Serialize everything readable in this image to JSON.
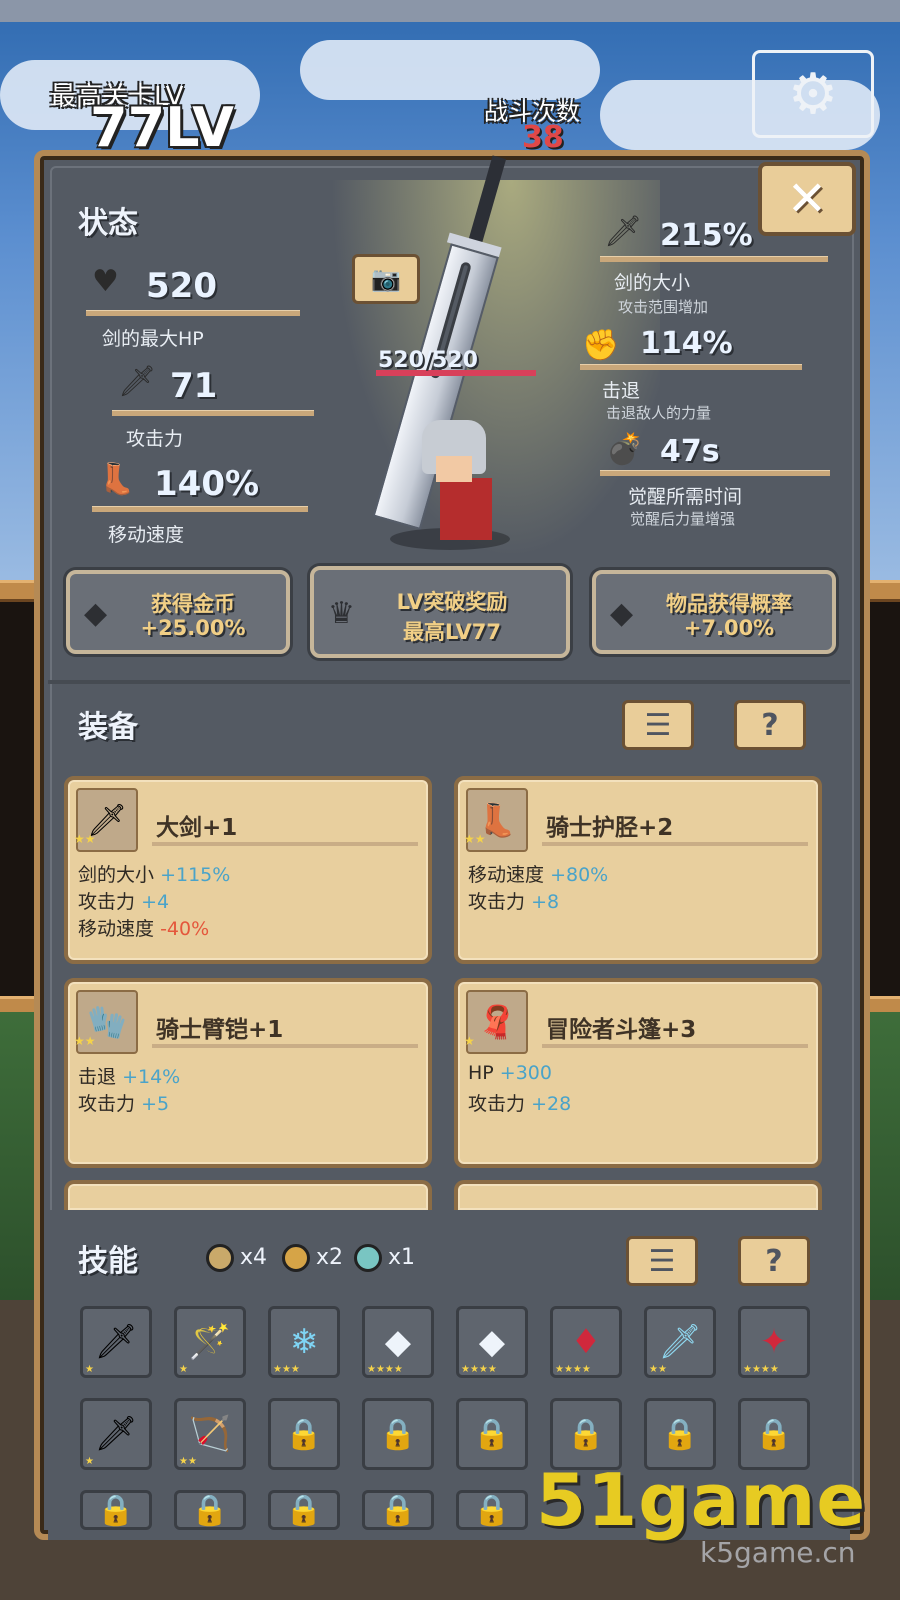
{
  "hud": {
    "best_stage_label": "最高关卡LV",
    "best_stage_value": "77LV",
    "battle_count_label": "战斗次数",
    "battle_count_value": "38"
  },
  "status": {
    "title": "状态",
    "left_stats": [
      {
        "value": "520",
        "label": "剑的最大HP",
        "icon": "heart-icon"
      },
      {
        "value": "71",
        "label": "攻击力",
        "icon": "sword-icon"
      },
      {
        "value": "140%",
        "label": "移动速度",
        "icon": "boots-icon"
      }
    ],
    "right_stats": [
      {
        "value": "215%",
        "label": "剑的大小",
        "sub": "攻击范围增加",
        "icon": "sword-icon"
      },
      {
        "value": "114%",
        "label": "击退",
        "sub": "击退敌人的力量",
        "icon": "fist-icon"
      },
      {
        "value": "47s",
        "label": "觉醒所需时间",
        "sub": "觉醒后力量增强",
        "icon": "bomb-icon"
      }
    ],
    "hp_text": "520/520"
  },
  "bonuses": [
    {
      "title": "获得金币",
      "value": "+25.00%",
      "icon": "diamond-icon"
    },
    {
      "title": "LV突破奖励",
      "value": "最高LV77",
      "icon": "crown-icon"
    },
    {
      "title": "物品获得概率",
      "value": "+7.00%",
      "icon": "diamond-icon"
    }
  ],
  "equipment": {
    "title": "装备",
    "menu_label": "☰",
    "help_label": "?",
    "items": [
      {
        "name": "大剑+1",
        "icon": "greatsword-icon",
        "stats": [
          {
            "label": "剑的大小",
            "value": "+115%",
            "sign": "pos"
          },
          {
            "label": "攻击力",
            "value": "+4",
            "sign": "pos"
          },
          {
            "label": "移动速度",
            "value": "-40%",
            "sign": "neg"
          }
        ]
      },
      {
        "name": "骑士护胫+2",
        "icon": "greaves-icon",
        "stats": [
          {
            "label": "移动速度",
            "value": "+80%",
            "sign": "pos"
          },
          {
            "label": "攻击力",
            "value": "+8",
            "sign": "pos"
          }
        ]
      },
      {
        "name": "骑士臂铠+1",
        "icon": "gauntlet-icon",
        "stats": [
          {
            "label": "击退",
            "value": "+14%",
            "sign": "pos"
          },
          {
            "label": "攻击力",
            "value": "+5",
            "sign": "pos"
          }
        ]
      },
      {
        "name": "冒险者斗篷+3",
        "icon": "cloak-icon",
        "stats": [
          {
            "label": "HP",
            "value": "+300",
            "sign": "pos"
          },
          {
            "label": "攻击力",
            "value": "+28",
            "sign": "pos"
          }
        ]
      }
    ]
  },
  "skills": {
    "title": "技能",
    "menu_label": "☰",
    "help_label": "?",
    "resources": [
      {
        "count": "x4",
        "color": "#c9a96a"
      },
      {
        "count": "x2",
        "color": "#d6a447"
      },
      {
        "count": "x1",
        "color": "#79c5c2"
      }
    ]
  },
  "watermark": "51game",
  "watermark_sub": "k5game.cn",
  "colors": {
    "accent_gold": "#f1cf86",
    "positive": "#4aa3c9",
    "negative": "#e4573c",
    "panel": "#545a63"
  }
}
